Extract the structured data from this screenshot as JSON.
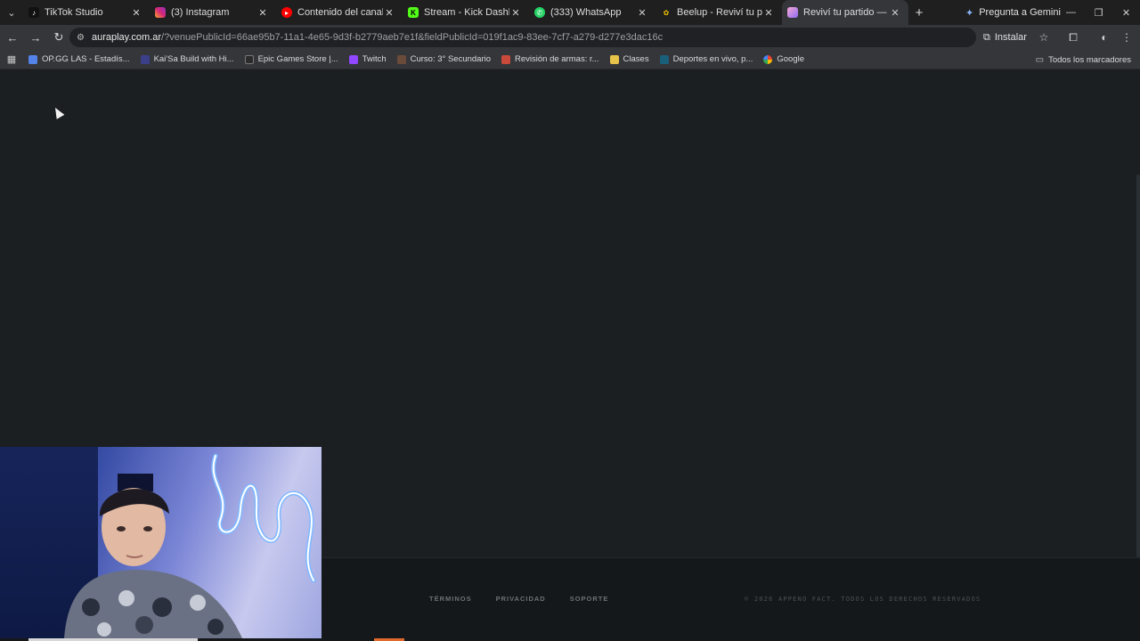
{
  "browser": {
    "tabs": [
      {
        "title": "TikTok Studio",
        "favicon": "tiktok-icon",
        "color": "#111111",
        "active": false
      },
      {
        "title": "(3) Instagram",
        "favicon": "instagram-icon",
        "color": "#d62976",
        "active": false
      },
      {
        "title": "Contenido del canal - YouT",
        "favicon": "youtube-icon",
        "color": "#ff0000",
        "active": false
      },
      {
        "title": "Stream - Kick Dashboard",
        "favicon": "kick-icon",
        "color": "#53fc18",
        "active": false
      },
      {
        "title": "(333) WhatsApp",
        "favicon": "whatsapp-icon",
        "color": "#25d366",
        "active": false
      },
      {
        "title": "Beelup - Reviví tu partido",
        "favicon": "beelup-icon",
        "color": "#f5c400",
        "active": false
      },
      {
        "title": "Reviví tu partido — AuraPl",
        "favicon": "auraplay-icon",
        "color": "#b06fe8",
        "active": true
      }
    ],
    "gemini_label": "Pregunta a Gemini",
    "url_host": "auraplay.com.ar",
    "url_path": "/?venuePublicId=66ae95b7-11a1-4e65-9d3f-b2779aeb7e1f&fieldPublicId=019f1ac9-83ee-7cf7-a279-d277e3dac16c",
    "install_label": "Instalar",
    "bookmarks": [
      {
        "label": "OP.GG LAS - Estadís...",
        "color": "#5383e8"
      },
      {
        "label": "Kai'Sa Build with Hi...",
        "color": "#3b3f8a"
      },
      {
        "label": "Epic Games Store |...",
        "color": "#2b2b2b"
      },
      {
        "label": "Twitch",
        "color": "#9146ff"
      },
      {
        "label": "Curso: 3° Secundario",
        "color": "#6a4b3a"
      },
      {
        "label": "Revisión de armas: r...",
        "color": "#c94a3a"
      },
      {
        "label": "Clases",
        "color": "#e8c34a"
      },
      {
        "label": "Deportes en vivo, p...",
        "color": "#1a5f7a"
      },
      {
        "label": "Google",
        "color": "#4285f4"
      }
    ],
    "all_bookmarks_label": "Todos los marcadores"
  },
  "footer": {
    "links": [
      "TÉRMINOS",
      "PRIVACIDAD",
      "SOPORTE"
    ],
    "copyright": "© 2026 APPENO FACT. TODOS LOS DERECHOS RESERVADOS"
  },
  "colors": {
    "page_bg": "#1b1f22",
    "footer_bg": "#15181a",
    "chrome_dark": "#1f1f1f",
    "chrome_toolbar": "#35363a"
  }
}
